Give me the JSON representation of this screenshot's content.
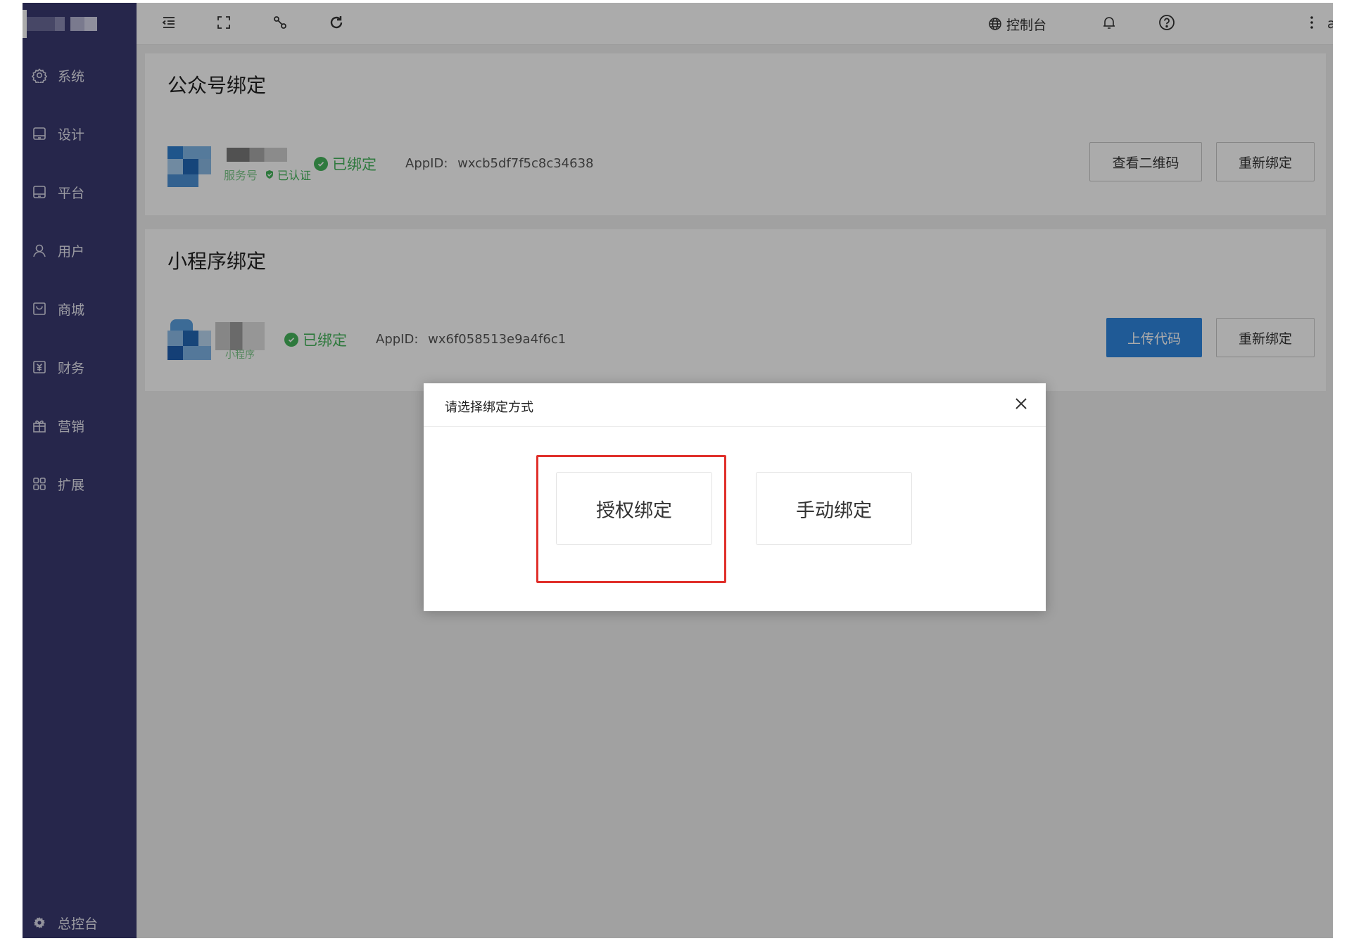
{
  "header": {
    "console_label": "控制台",
    "user_label": "admin"
  },
  "sidebar": {
    "items": [
      {
        "label": "系统",
        "icon": "settings-icon"
      },
      {
        "label": "设计",
        "icon": "monitor-icon"
      },
      {
        "label": "平台",
        "icon": "monitor-icon"
      },
      {
        "label": "用户",
        "icon": "user-icon"
      },
      {
        "label": "商城",
        "icon": "mall-icon"
      },
      {
        "label": "财务",
        "icon": "finance-icon"
      },
      {
        "label": "营销",
        "icon": "gift-icon"
      },
      {
        "label": "扩展",
        "icon": "grid-icon"
      }
    ],
    "footer_label": "总控台"
  },
  "official_account": {
    "title": "公众号绑定",
    "account_type": "服务号",
    "verified_label": "已认证",
    "status": "已绑定",
    "appid_label": "AppID:",
    "appid_value": "wxcb5df7f5c8c34638",
    "qr_button": "查看二维码",
    "rebind_button": "重新绑定"
  },
  "mini_program": {
    "title": "小程序绑定",
    "type_label": "小程序",
    "status": "已绑定",
    "appid_label": "AppID:",
    "appid_value": "wx6f058513e9a4f6c1",
    "upload_button": "上传代码",
    "rebind_button": "重新绑定"
  },
  "dialog": {
    "title": "请选择绑定方式",
    "auth_bind": "授权绑定",
    "manual_bind": "手动绑定"
  },
  "colors": {
    "sidebar_bg": "#3a3970",
    "success": "#45b55b",
    "primary": "#2f86e0",
    "highlight": "#e0302b"
  }
}
